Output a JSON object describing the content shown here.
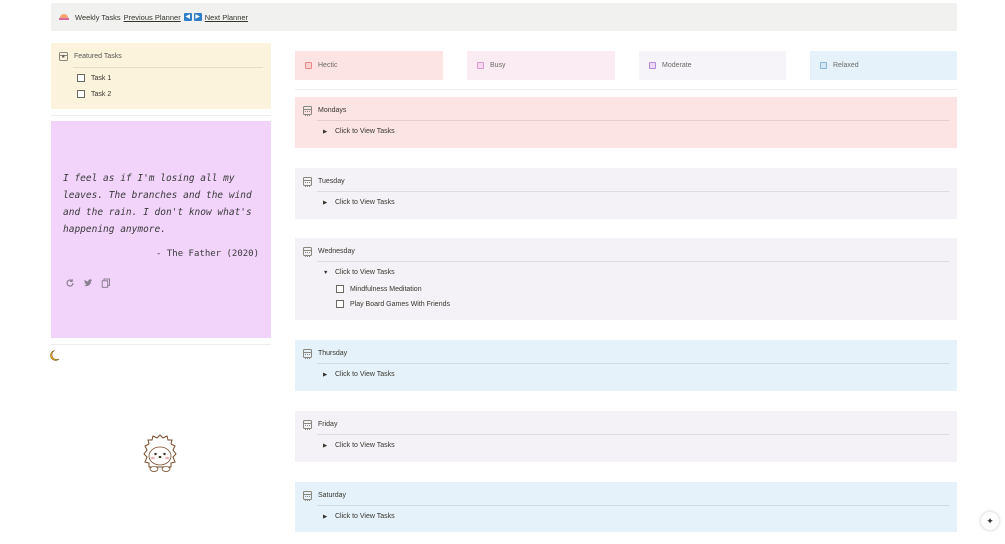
{
  "topbar": {
    "title": "Weekly Tasks",
    "prev_link": "Previous Planner",
    "next_link": "Next Planner",
    "prev_arrow": "◀",
    "next_arrow": "▶"
  },
  "featured": {
    "title": "Featured Tasks",
    "tasks": [
      "Task 1",
      "Task 2"
    ]
  },
  "quote": {
    "text": "I feel as if I'm losing all my leaves. The branches and the wind and the rain. I don't know what's happening anymore.",
    "author": "- The Father (2020)"
  },
  "legend": [
    {
      "label": "Hectic",
      "bg": "#fde4e4",
      "color": "#e88a8a"
    },
    {
      "label": "Busy",
      "bg": "#faecf2",
      "color": "#d69ad1"
    },
    {
      "label": "Moderate",
      "bg": "#f6f3f9",
      "color": "#b48ad6"
    },
    {
      "label": "Relaxed",
      "bg": "#e6f2f9",
      "color": "#8ab6d6"
    }
  ],
  "days": [
    {
      "name": "Mondays",
      "toggle": "Click to View Tasks",
      "bg": "#fde4e4",
      "open": false,
      "tasks": []
    },
    {
      "name": "Tuesday",
      "toggle": "Click to View Tasks",
      "bg": "#f4f2f6",
      "open": false,
      "tasks": []
    },
    {
      "name": "Wednesday",
      "toggle": "Click to View Tasks",
      "bg": "#f4f2f6",
      "open": true,
      "tasks": [
        "Mindfulness Meditation",
        "Play Board Games With Friends"
      ]
    },
    {
      "name": "Thursday",
      "toggle": "Click to View Tasks",
      "bg": "#e6f2f9",
      "open": false,
      "tasks": []
    },
    {
      "name": "Friday",
      "toggle": "Click to View Tasks",
      "bg": "#f4f2f6",
      "open": false,
      "tasks": []
    },
    {
      "name": "Saturday",
      "toggle": "Click to View Tasks",
      "bg": "#e6f2f9",
      "open": false,
      "tasks": []
    }
  ],
  "icons": {
    "topbar": "cake-icon",
    "featured": "calendar-star-icon",
    "day": "calendar-icon",
    "refresh": "refresh-icon",
    "twitter": "twitter-icon",
    "copy": "copy-icon",
    "moon": "crescent-moon-icon",
    "mascot": "hedgehog-icon",
    "assistant": "sparkle-icon"
  }
}
